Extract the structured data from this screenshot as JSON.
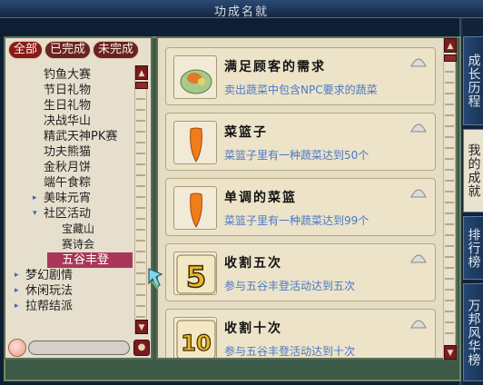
{
  "window": {
    "title": "功成名就"
  },
  "filters": [
    {
      "label": "全部",
      "active": true
    },
    {
      "label": "已完成",
      "active": false
    },
    {
      "label": "未完成",
      "active": false
    }
  ],
  "tree": [
    {
      "label": "钓鱼大赛",
      "level": 1
    },
    {
      "label": "节日礼物",
      "level": 1
    },
    {
      "label": "生日礼物",
      "level": 1
    },
    {
      "label": "决战华山",
      "level": 1
    },
    {
      "label": "精武天神PK赛",
      "level": 1
    },
    {
      "label": "功夫熊猫",
      "level": 1
    },
    {
      "label": "金秋月饼",
      "level": 1
    },
    {
      "label": "端午食粽",
      "level": 1
    },
    {
      "label": "美味元宵",
      "level": 1,
      "arrow": "▸"
    },
    {
      "label": "社区活动",
      "level": 1,
      "arrow": "▾"
    },
    {
      "label": "宝藏山",
      "level": 2
    },
    {
      "label": "赛诗会",
      "level": 2
    },
    {
      "label": "五谷丰登",
      "level": 2,
      "selected": true
    },
    {
      "label": "梦幻剧情",
      "level": 0,
      "arrow": "▸"
    },
    {
      "label": "休闲玩法",
      "level": 0,
      "arrow": "▸"
    },
    {
      "label": "拉帮结派",
      "level": 0,
      "arrow": "▸"
    }
  ],
  "achievements": [
    {
      "name": "满足顾客的需求",
      "desc": "卖出蔬菜中包含NPC要求的蔬菜",
      "icon": "vegetable-basket-icon"
    },
    {
      "name": "菜篮子",
      "desc": "菜篮子里有一种蔬菜达到50个",
      "icon": "carrot-icon"
    },
    {
      "name": "单调的菜篮",
      "desc": "菜篮子里有一种蔬菜达到99个",
      "icon": "carrot-icon"
    },
    {
      "name": "收割五次",
      "desc": "参与五谷丰登活动达到五次",
      "icon": "number-five-icon",
      "badge": "5"
    },
    {
      "name": "收割十次",
      "desc": "参与五谷丰登活动达到十次",
      "icon": "number-ten-icon",
      "badge": "10"
    }
  ],
  "side_tabs": [
    {
      "label": "成长历程",
      "active": false
    },
    {
      "label": "我的成就",
      "active": true
    },
    {
      "label": "排行榜",
      "active": false
    },
    {
      "label": "万邦风华榜",
      "active": false
    }
  ],
  "colors": {
    "accent": "#7a1a22",
    "desc_text": "#4a78c4",
    "selected_row": "#a8375a"
  }
}
